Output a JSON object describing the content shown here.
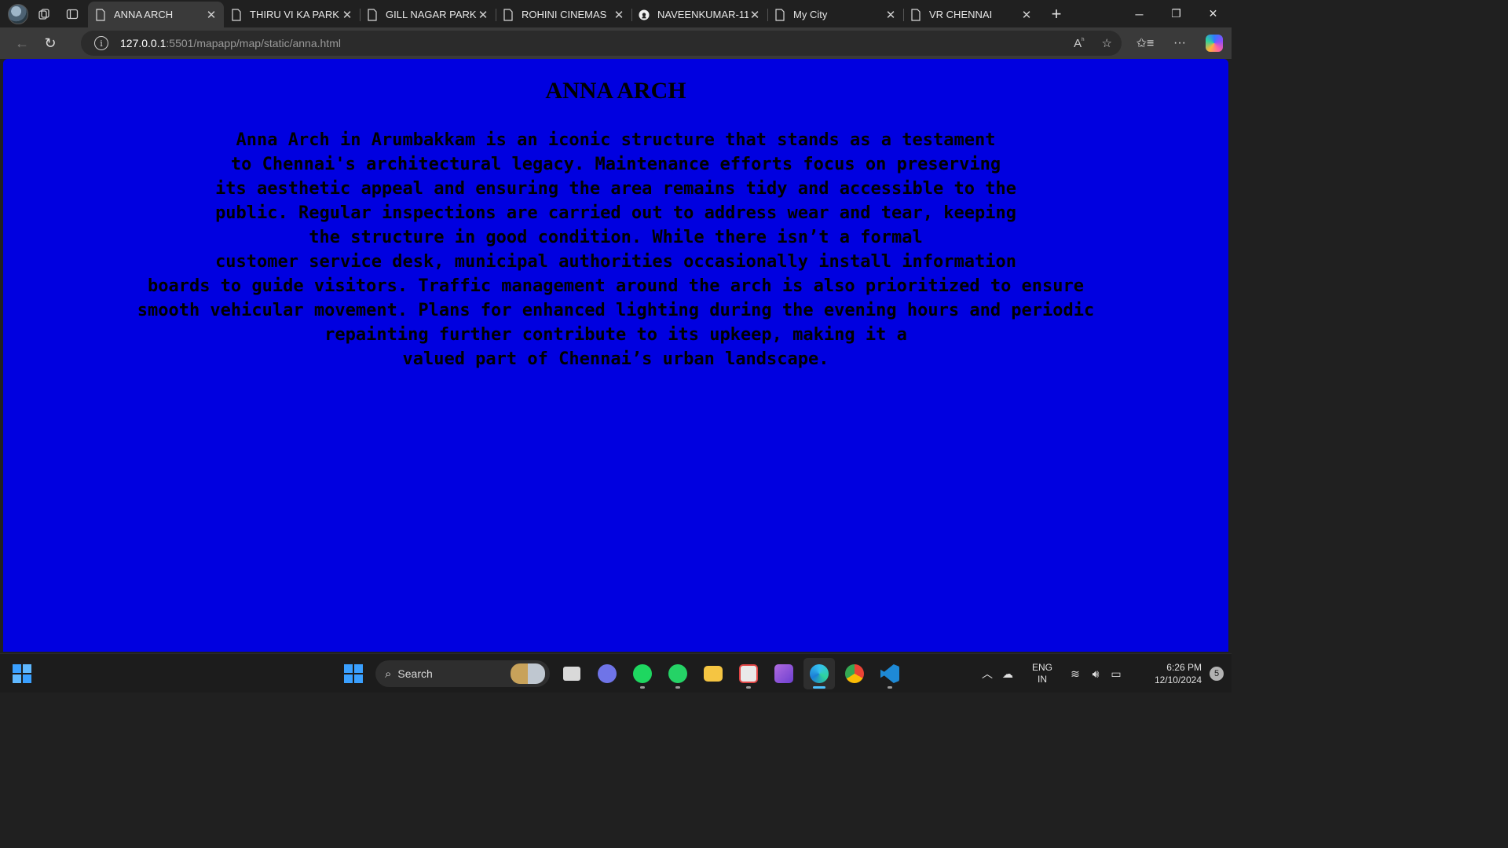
{
  "browser": {
    "tabs": [
      {
        "title": "ANNA ARCH",
        "icon": "page-icon",
        "active": true
      },
      {
        "title": "THIRU VI KA PARK",
        "icon": "page-icon",
        "active": false
      },
      {
        "title": "GILL NAGAR PARK",
        "icon": "page-icon",
        "active": false
      },
      {
        "title": "ROHINI CINEMAS",
        "icon": "page-icon",
        "active": false
      },
      {
        "title": "NAVEENKUMAR-11-",
        "icon": "github-icon",
        "active": false
      },
      {
        "title": "My City",
        "icon": "page-icon",
        "active": false
      },
      {
        "title": "VR CHENNAI",
        "icon": "page-icon",
        "active": false
      }
    ],
    "url_host": "127.0.0.1",
    "url_rest": ":5501/mapapp/map/static/anna.html"
  },
  "page": {
    "heading": "ANNA ARCH",
    "body_lines": [
      "Anna Arch in Arumbakkam is an iconic structure that stands as a testament",
      "to Chennai's architectural legacy. Maintenance efforts focus on preserving",
      "its aesthetic appeal and ensuring the area remains tidy and accessible to the",
      "public. Regular inspections are carried out to address wear and tear, keeping",
      "the structure in good condition. While there isn’t a formal",
      "customer service desk, municipal authorities occasionally install information",
      "boards to guide visitors. Traffic management around the arch is also prioritized to ensure",
      "smooth vehicular movement. Plans for enhanced lighting during the evening hours and periodic",
      "repainting further contribute to its upkeep, making it a",
      "valued part of Chennai’s urban landscape."
    ],
    "background_color": "#0000e0"
  },
  "taskbar": {
    "search_label": "Search",
    "lang_line1": "ENG",
    "lang_line2": "IN",
    "time": "6:26 PM",
    "date": "12/10/2024",
    "notification_count": "5"
  }
}
